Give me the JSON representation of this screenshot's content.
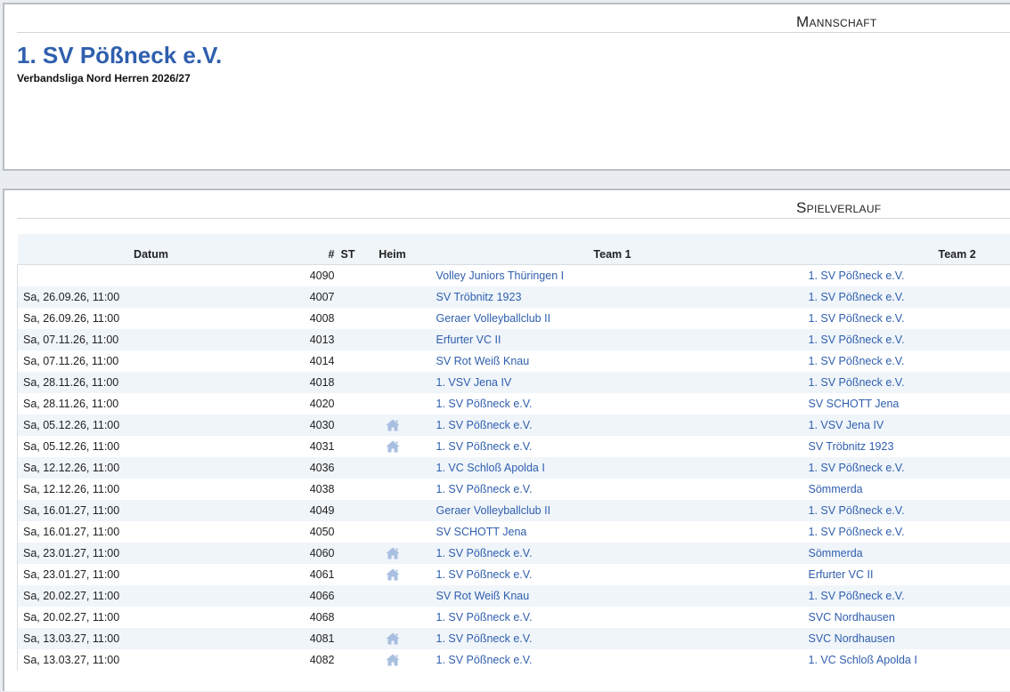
{
  "team_section": {
    "title": "Mannschaft",
    "club_name": "1. SV Pößneck e.V.",
    "league": "Verbandsliga Nord Herren 2026/27"
  },
  "games_section": {
    "title": "Spielverlauf",
    "columns": {
      "date": "Datum",
      "number": "#",
      "st": "ST",
      "home": "Heim",
      "team1": "Team 1",
      "team2": "Team 2"
    },
    "rows": [
      {
        "date": "",
        "number": "4090",
        "home": false,
        "team1": "Volley Juniors Thüringen I",
        "team2": "1. SV Pößneck e.V."
      },
      {
        "date": "Sa, 26.09.26, 11:00",
        "number": "4007",
        "home": false,
        "team1": "SV Tröbnitz 1923",
        "team2": "1. SV Pößneck e.V."
      },
      {
        "date": "Sa, 26.09.26, 11:00",
        "number": "4008",
        "home": false,
        "team1": "Geraer Volleyballclub II",
        "team2": "1. SV Pößneck e.V."
      },
      {
        "date": "Sa, 07.11.26, 11:00",
        "number": "4013",
        "home": false,
        "team1": "Erfurter VC II",
        "team2": "1. SV Pößneck e.V."
      },
      {
        "date": "Sa, 07.11.26, 11:00",
        "number": "4014",
        "home": false,
        "team1": "SV Rot Weiß Knau",
        "team2": "1. SV Pößneck e.V."
      },
      {
        "date": "Sa, 28.11.26, 11:00",
        "number": "4018",
        "home": false,
        "team1": "1. VSV Jena IV",
        "team2": "1. SV Pößneck e.V."
      },
      {
        "date": "Sa, 28.11.26, 11:00",
        "number": "4020",
        "home": false,
        "team1": "1. SV Pößneck e.V.",
        "team2": "SV SCHOTT Jena"
      },
      {
        "date": "Sa, 05.12.26, 11:00",
        "number": "4030",
        "home": true,
        "team1": "1. SV Pößneck e.V.",
        "team2": "1. VSV Jena IV"
      },
      {
        "date": "Sa, 05.12.26, 11:00",
        "number": "4031",
        "home": true,
        "team1": "1. SV Pößneck e.V.",
        "team2": "SV Tröbnitz 1923"
      },
      {
        "date": "Sa, 12.12.26, 11:00",
        "number": "4036",
        "home": false,
        "team1": "1. VC Schloß Apolda I",
        "team2": "1. SV Pößneck e.V."
      },
      {
        "date": "Sa, 12.12.26, 11:00",
        "number": "4038",
        "home": false,
        "team1": "1. SV Pößneck e.V.",
        "team2": "Sömmerda"
      },
      {
        "date": "Sa, 16.01.27, 11:00",
        "number": "4049",
        "home": false,
        "team1": "Geraer Volleyballclub II",
        "team2": "1. SV Pößneck e.V."
      },
      {
        "date": "Sa, 16.01.27, 11:00",
        "number": "4050",
        "home": false,
        "team1": "SV SCHOTT Jena",
        "team2": "1. SV Pößneck e.V."
      },
      {
        "date": "Sa, 23.01.27, 11:00",
        "number": "4060",
        "home": true,
        "team1": "1. SV Pößneck e.V.",
        "team2": "Sömmerda"
      },
      {
        "date": "Sa, 23.01.27, 11:00",
        "number": "4061",
        "home": true,
        "team1": "1. SV Pößneck e.V.",
        "team2": "Erfurter VC II"
      },
      {
        "date": "Sa, 20.02.27, 11:00",
        "number": "4066",
        "home": false,
        "team1": "SV Rot Weiß Knau",
        "team2": "1. SV Pößneck e.V."
      },
      {
        "date": "Sa, 20.02.27, 11:00",
        "number": "4068",
        "home": false,
        "team1": "1. SV Pößneck e.V.",
        "team2": "SVC Nordhausen"
      },
      {
        "date": "Sa, 13.03.27, 11:00",
        "number": "4081",
        "home": true,
        "team1": "1. SV Pößneck e.V.",
        "team2": "SVC Nordhausen"
      },
      {
        "date": "Sa, 13.03.27, 11:00",
        "number": "4082",
        "home": true,
        "team1": "1. SV Pößneck e.V.",
        "team2": "1. VC Schloß Apolda I"
      }
    ]
  },
  "icons": {
    "home": "home-icon"
  },
  "colors": {
    "link": "#2f5fae",
    "icon": "#a9bfdf",
    "stripe": "#f0f5fa"
  }
}
